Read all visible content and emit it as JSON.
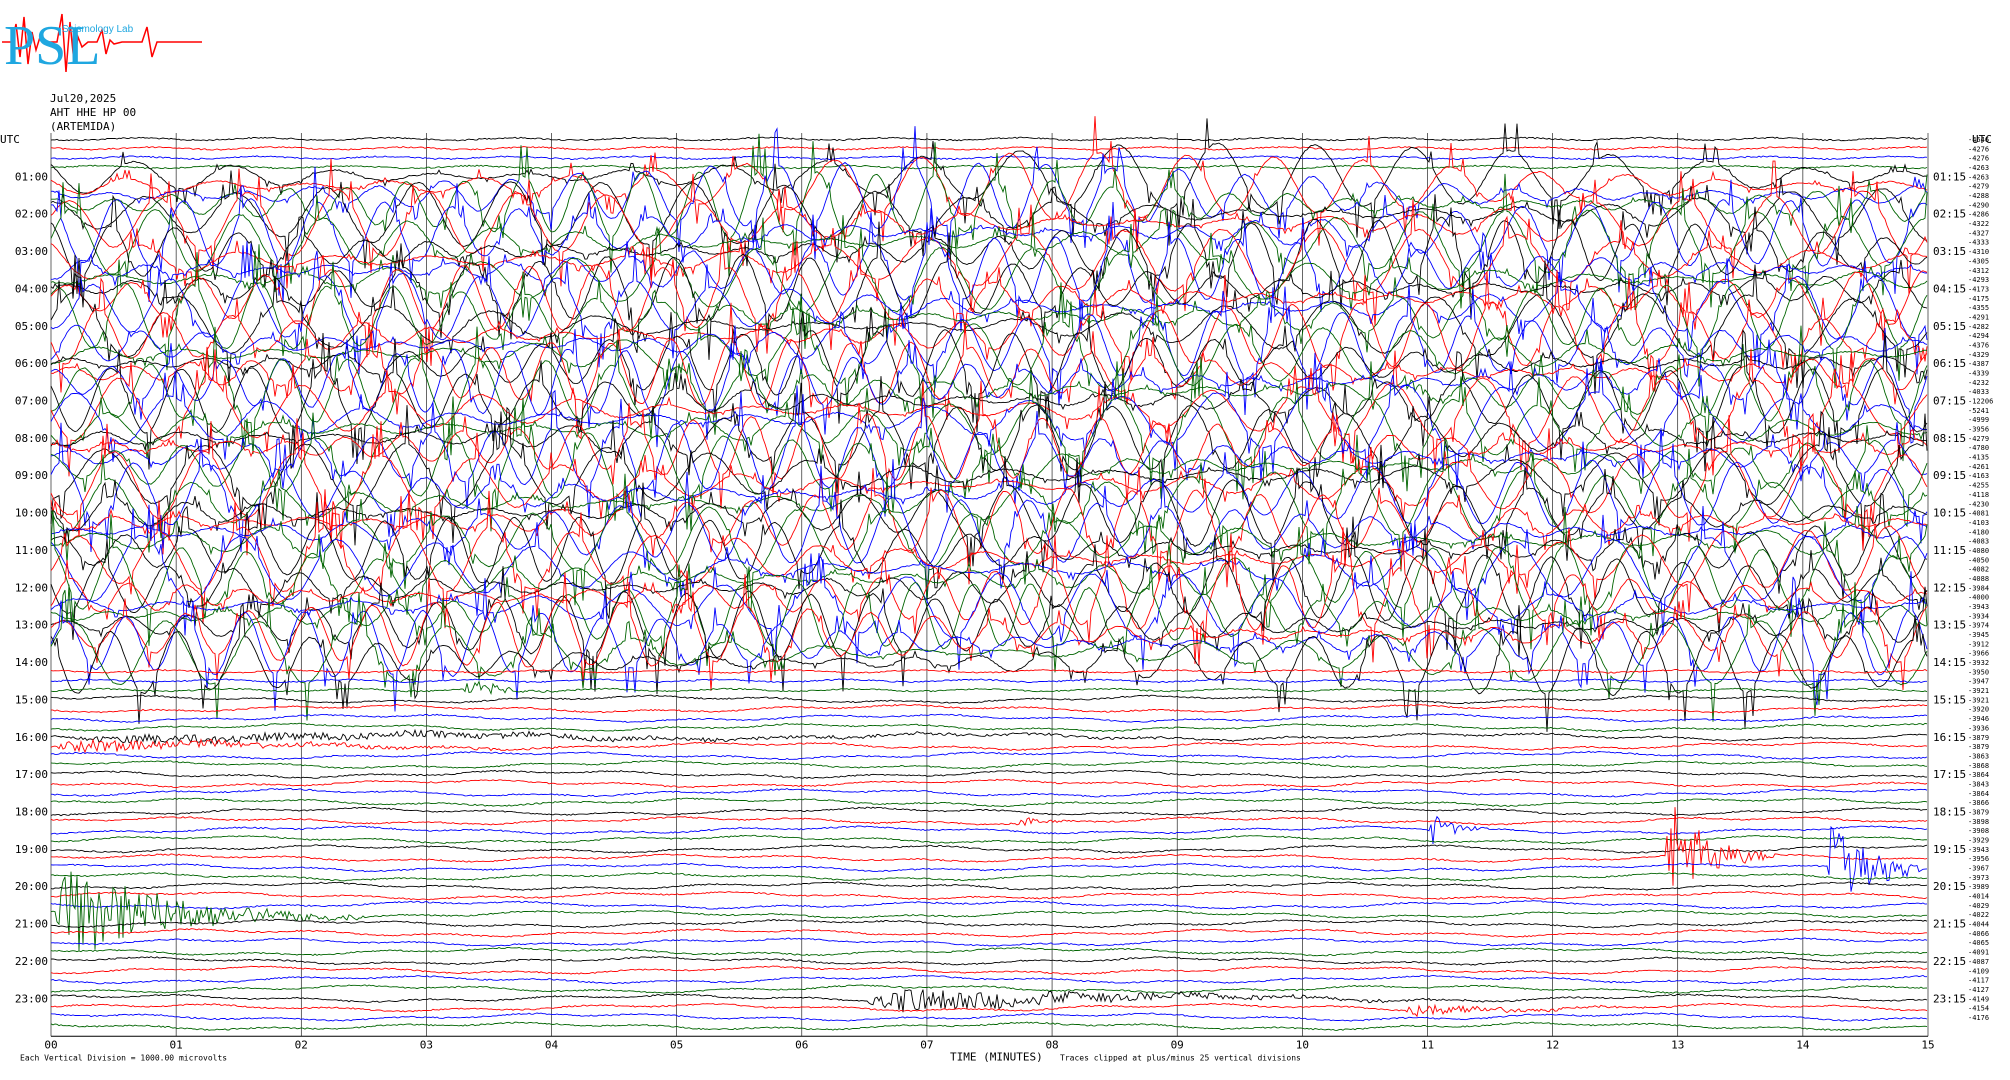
{
  "header": {
    "logo_text": "PSL",
    "logo_subtext": "Seismology Lab",
    "date": "Jul20,2025",
    "channel": "AHT HHE HP 00",
    "station": "(ARTEMIDA)"
  },
  "axis": {
    "left_title": "UTC",
    "right_title": "UTC",
    "x_title": "TIME (MINUTES)",
    "left_ticks": [
      "01:00",
      "02:00",
      "03:00",
      "04:00",
      "05:00",
      "06:00",
      "07:00",
      "08:00",
      "09:00",
      "10:00",
      "11:00",
      "12:00",
      "13:00",
      "14:00",
      "15:00",
      "16:00",
      "17:00",
      "18:00",
      "19:00",
      "20:00",
      "21:00",
      "22:00",
      "23:00"
    ],
    "right_ticks": [
      "01:15",
      "02:15",
      "03:15",
      "04:15",
      "05:15",
      "06:15",
      "07:15",
      "08:15",
      "09:15",
      "10:15",
      "11:15",
      "12:15",
      "13:15",
      "14:15",
      "15:15",
      "16:15",
      "17:15",
      "18:15",
      "19:15",
      "20:15",
      "21:15",
      "22:15",
      "23:15"
    ],
    "x_ticks": [
      "00",
      "01",
      "02",
      "03",
      "04",
      "05",
      "06",
      "07",
      "08",
      "09",
      "10",
      "11",
      "12",
      "13",
      "14",
      "15"
    ]
  },
  "footer": {
    "scale_note": "Each Vertical Division = 1000.00 microvolts",
    "clip_note": "Traces clipped at plus/minus 25 vertical divisions"
  },
  "chart_data": {
    "type": "line",
    "title": "",
    "xlabel": "TIME (MINUTES)",
    "ylabel": "UTC",
    "xlim": [
      0,
      15
    ],
    "trace_count": 96,
    "trace_minutes": 15,
    "grid": "vertical lines every minute",
    "series_colors": [
      "#000000",
      "#ff0000",
      "#0000ff",
      "#006400"
    ],
    "trace_offsets": [
      "-4646",
      "-4276",
      "-4276",
      "-4263",
      "-4263",
      "-4279",
      "-4288",
      "-4290",
      "-4286",
      "-4322",
      "-4327",
      "-4333",
      "-4310",
      "-4305",
      "-4312",
      "-4293",
      "-4173",
      "-4175",
      "-4355",
      "-4291",
      "-4282",
      "-4294",
      "-4376",
      "-4329",
      "-4387",
      "-4339",
      "-4232",
      "-4033",
      "-12206",
      "-5241",
      "-4999",
      "-3956",
      "-4279",
      "-4780",
      "-4135",
      "-4261",
      "-4163",
      "-4255",
      "-4118",
      "-4230",
      "-4081",
      "-4103",
      "-4180",
      "-4083",
      "-4080",
      "-4050",
      "-4082",
      "-4088",
      "-3984",
      "-4000",
      "-3943",
      "-3934",
      "-3974",
      "-3945",
      "-3912",
      "-3966",
      "-3932",
      "-3950",
      "-3947",
      "-3921",
      "-3921",
      "-3920",
      "-3946",
      "-3936",
      "-3879",
      "-3879",
      "-3863",
      "-3868",
      "-3864",
      "-3843",
      "-3864",
      "-3866",
      "-3879",
      "-3898",
      "-3908",
      "-3929",
      "-3943",
      "-3956",
      "-3967",
      "-3973",
      "-3989",
      "-4014",
      "-4029",
      "-4022",
      "-4044",
      "-4066",
      "-4065",
      "-4091",
      "-4087",
      "-4109",
      "-4117",
      "-4127",
      "-4149",
      "-4154",
      "-4176"
    ],
    "events": [
      {
        "row": 83,
        "start_min": 0.0,
        "end_min": 2.5,
        "amplitude": 60
      },
      {
        "row": 77,
        "start_min": 12.9,
        "end_min": 13.8,
        "amplitude": 70
      },
      {
        "row": 78,
        "start_min": 14.2,
        "end_min": 14.95,
        "amplitude": 90
      },
      {
        "row": 59,
        "start_min": 3.3,
        "end_min": 4.1,
        "amplitude": 12
      },
      {
        "row": 64,
        "start_min": 0.0,
        "end_min": 15,
        "amplitude": 6
      },
      {
        "row": 65,
        "start_min": 0.0,
        "end_min": 5.5,
        "amplitude": 8
      },
      {
        "row": 73,
        "start_min": 7.7,
        "end_min": 8.1,
        "amplitude": 12
      },
      {
        "row": 74,
        "start_min": 11.0,
        "end_min": 11.5,
        "amplitude": 22
      },
      {
        "row": 92,
        "start_min": 6.5,
        "end_min": 11.5,
        "amplitude": 16
      },
      {
        "row": 93,
        "start_min": 10.8,
        "end_min": 13.2,
        "amplitude": 8
      },
      {
        "row": 16,
        "start_min": 3.4,
        "end_min": 3.9,
        "amplitude": 8
      },
      {
        "row": 23,
        "start_min": 5.9,
        "end_min": 7.0,
        "amplitude": 10
      },
      {
        "row": 27,
        "start_min": 10.8,
        "end_min": 11.5,
        "amplitude": 12
      }
    ],
    "clipped_rows": {
      "start": 4,
      "end": 56,
      "amplitude": 180
    }
  }
}
